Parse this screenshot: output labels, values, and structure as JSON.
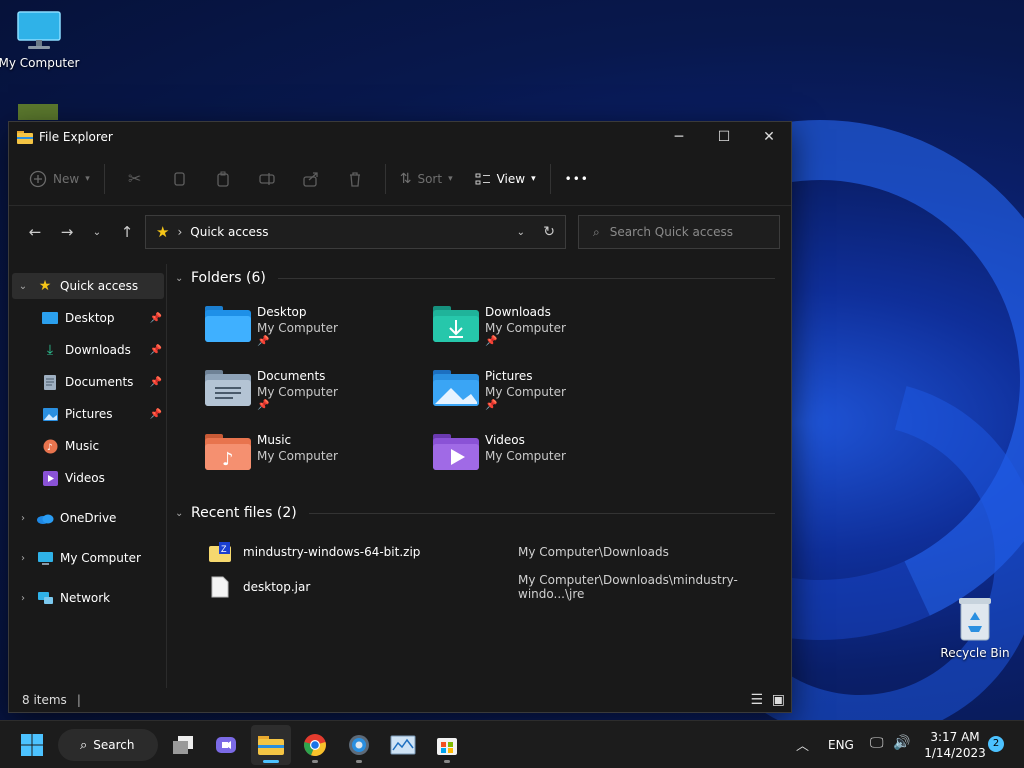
{
  "desktop": {
    "icons": [
      {
        "label": "My Computer"
      },
      {
        "label": "Recycle Bin"
      }
    ]
  },
  "window": {
    "title": "File Explorer",
    "controls": {
      "minimize": "─",
      "maximize": "☐",
      "close": "✕"
    }
  },
  "toolbar": {
    "new_label": "New",
    "sort_label": "Sort",
    "view_label": "View",
    "more_label": "•••"
  },
  "address": {
    "current": "Quick access",
    "separator": "›",
    "search_placeholder": "Search Quick access"
  },
  "sidebar": {
    "items": [
      {
        "label": "Quick access",
        "icon": "star-icon",
        "pinned": false
      },
      {
        "label": "Desktop",
        "icon": "desktop-folder-icon",
        "pinned": true
      },
      {
        "label": "Downloads",
        "icon": "download-icon",
        "pinned": true
      },
      {
        "label": "Documents",
        "icon": "documents-icon",
        "pinned": true
      },
      {
        "label": "Pictures",
        "icon": "pictures-icon",
        "pinned": true
      },
      {
        "label": "Music",
        "icon": "music-icon",
        "pinned": false
      },
      {
        "label": "Videos",
        "icon": "videos-icon",
        "pinned": false
      },
      {
        "label": "OneDrive",
        "icon": "cloud-icon",
        "pinned": false
      },
      {
        "label": "My Computer",
        "icon": "computer-icon",
        "pinned": false
      },
      {
        "label": "Network",
        "icon": "network-icon",
        "pinned": false
      }
    ]
  },
  "main": {
    "folders_header": "Folders (6)",
    "folders": [
      {
        "name": "Desktop",
        "location": "My Computer",
        "pinned": true,
        "color": "#1e90e8"
      },
      {
        "name": "Downloads",
        "location": "My Computer",
        "pinned": true,
        "color": "#1fb39a"
      },
      {
        "name": "Documents",
        "location": "My Computer",
        "pinned": true,
        "color": "#8fa3b8"
      },
      {
        "name": "Pictures",
        "location": "My Computer",
        "pinned": true,
        "color": "#2a8fe0"
      },
      {
        "name": "Music",
        "location": "My Computer",
        "pinned": false,
        "color": "#e8744e"
      },
      {
        "name": "Videos",
        "location": "My Computer",
        "pinned": false,
        "color": "#8a52d6"
      }
    ],
    "recent_header": "Recent files (2)",
    "recent": [
      {
        "name": "mindustry-windows-64-bit.zip",
        "path": "My Computer\\Downloads"
      },
      {
        "name": "desktop.jar",
        "path": "My Computer\\Downloads\\mindustry-windo...\\jre"
      }
    ]
  },
  "status": {
    "items": "8 items"
  },
  "taskbar": {
    "search_label": "Search",
    "lang": "ENG",
    "time": "3:17 AM",
    "date": "1/14/2023",
    "notifications": "2"
  },
  "colors": {
    "accent": "#4cc2ff",
    "window_bg": "#191919"
  }
}
